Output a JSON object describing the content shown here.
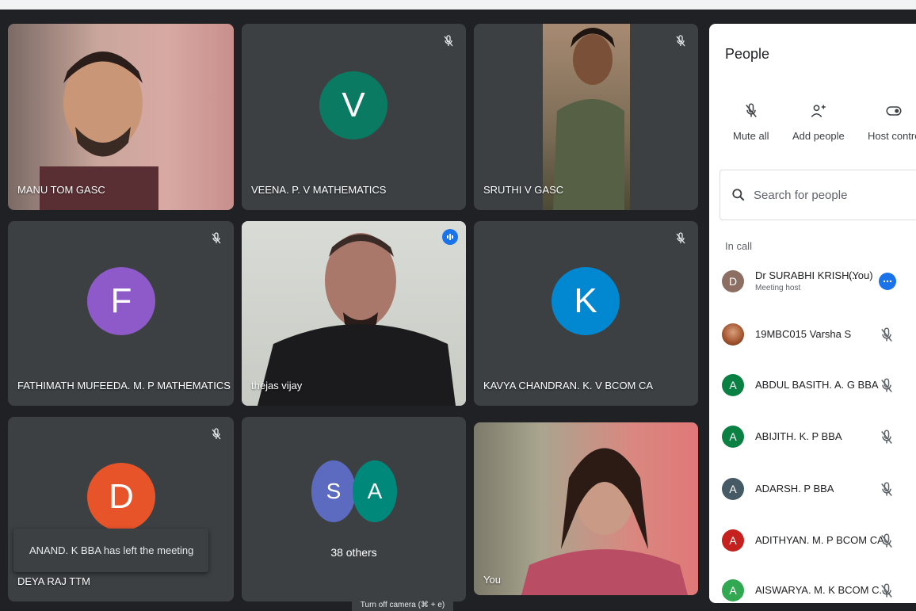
{
  "tiles": [
    {
      "name": "MANU TOM GASC"
    },
    {
      "name": "VEENA. P. V MATHEMATICS",
      "initial": "V"
    },
    {
      "name": "SRUTHI V GASC"
    },
    {
      "name": "FATHIMATH MUFEEDA. M. P MATHEMATICS",
      "initial": "F"
    },
    {
      "name": "thejas vijay"
    },
    {
      "name": "KAVYA CHANDRAN. K. V BCOM CA",
      "initial": "K"
    },
    {
      "name": "DEYA RAJ TTM",
      "initial": "D"
    },
    {
      "others_label": "38 others",
      "initial1": "S",
      "initial2": "A"
    },
    {
      "name": "You"
    }
  ],
  "toast": "ANAND. K BBA has left the meeting",
  "camera_hint": "Turn off camera (⌘ + e)",
  "panel": {
    "title": "People",
    "actions": [
      "Mute all",
      "Add people",
      "Host contro"
    ],
    "search_placeholder": "Search for people",
    "in_call_label": "In call",
    "people": [
      {
        "initial": "D",
        "name": "Dr SURABHI KRISH...",
        "you": "(You)",
        "sub": "Meeting host",
        "color": "#8d6e63"
      },
      {
        "initial": "",
        "name": "19MBC015 Varsha S",
        "color": "#a0522d"
      },
      {
        "initial": "A",
        "name": "ABDUL BASITH. A. G BBA",
        "color": "#0b8043"
      },
      {
        "initial": "A",
        "name": "ABIJITH. K. P BBA",
        "color": "#0b8043"
      },
      {
        "initial": "A",
        "name": "ADARSH. P BBA",
        "color": "#455a64"
      },
      {
        "initial": "A",
        "name": "ADITHYAN. M. P BCOM CA",
        "color": "#c5221f"
      },
      {
        "initial": "A",
        "name": "AISWARYA. M. K BCOM C...",
        "color": "#33a852"
      }
    ]
  },
  "colors": {
    "veena": "#0b7a63",
    "fathimath": "#8e59c8",
    "kavya": "#0288d1",
    "deya": "#e8542a",
    "s_avatar": "#5c6bc0",
    "a_avatar": "#00897b"
  }
}
